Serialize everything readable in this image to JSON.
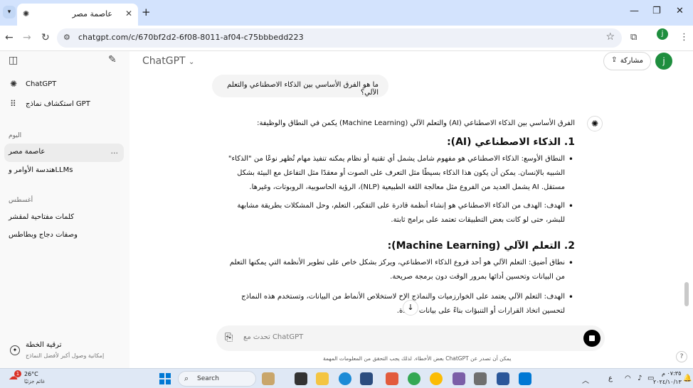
{
  "browser": {
    "tab_title": "عاصمة مصر",
    "tab_menu_icon": "chevron-down",
    "url": "chatgpt.com/c/670bf2d2-6f08-8011-af04-c75bbbedd223",
    "profile_initial": "j"
  },
  "sidebar": {
    "items": [
      {
        "label": "ChatGPT",
        "icon": "openai-logo"
      },
      {
        "label": "استكشاف نماذج GPT",
        "icon": "grid-icon"
      }
    ],
    "section_today": "اليوم",
    "today_chats": [
      "عاصمة مصر",
      "هندسة الأوامر وLLMs"
    ],
    "section_august": "أغسطس",
    "august_chats": [
      "كلمات مفتاحية لمقشر",
      "وصفات دجاج وبطاطس"
    ],
    "more_label": "...",
    "upgrade_title": "ترقية الخطة",
    "upgrade_sub": "إمكانية وصول أكبر لأفضل النماذج"
  },
  "header": {
    "model": "ChatGPT",
    "share_label": "مشاركة",
    "avatar_initial": "j"
  },
  "conversation": {
    "user_message": "ما هو الفرق الأساسي بين الذكاء الاصطناعي والتعلم الآلي؟",
    "intro": "الفرق الأساسي بين الذكاء الاصطناعي (AI) والتعلم الآلي (Machine Learning) يكمن في النطاق والوظيفة:",
    "h1": "1. الذكاء الاصطناعي (AI):",
    "b1": "النطاق الأوسع: الذكاء الاصطناعي هو مفهوم شامل يشمل أي تقنية أو نظام يمكنه تنفيذ مهام تُظهر نوعًا من \"الذكاء\" الشبيه بالإنسان. يمكن أن يكون هذا الذكاء بسيطًا مثل التعرف على الصوت أو معقدًا مثل التفاعل مع البيئة بشكل مستقل. AI يشمل العديد من الفروع مثل معالجة اللغة الطبيعية (NLP)، الرؤية الحاسوبية، الروبوتات، وغيرها.",
    "b2": "الهدف: الهدف من الذكاء الاصطناعي هو إنشاء أنظمة قادرة على التفكير، التعلم، وحل المشكلات بطريقة مشابهة للبشر، حتى لو كانت بعض التطبيقات تعتمد على برامج ثابتة.",
    "h2": "2. التعلم الآلي (Machine Learning):",
    "b3": "نطاق أضيق: التعلم الآلي هو أحد فروع الذكاء الاصطناعي، ويركز بشكل خاص على تطوير الأنظمة التي يمكنها التعلم من البيانات وتحسين أدائها بمرور الوقت دون برمجة صريحة.",
    "b4": "الهدف: التعلم الآلي يعتمد على الخوارزميات والنماذج الإح لاستخلاص الأنماط من البيانات، وتستخدم هذه النماذج لتحسين اتخاذ القرارات أو التنبؤات بناءً على بيانات جديدة."
  },
  "composer": {
    "placeholder": "تحدث مع ChatGPT",
    "disclaimer": "بعض الأخطاء. لذلك يجب التحقق من المعلومات المهمة ChatGPT يمكن أن تصدر عن",
    "help": "?"
  },
  "taskbar": {
    "weather_temp": "26°C",
    "weather_desc": "غائم جزئيًا",
    "weather_badge": "1",
    "search_label": "Search",
    "lang": "ع",
    "time": "٠٧:٣٥ م",
    "date": "٢٠٢٤/١٠/١٣"
  }
}
